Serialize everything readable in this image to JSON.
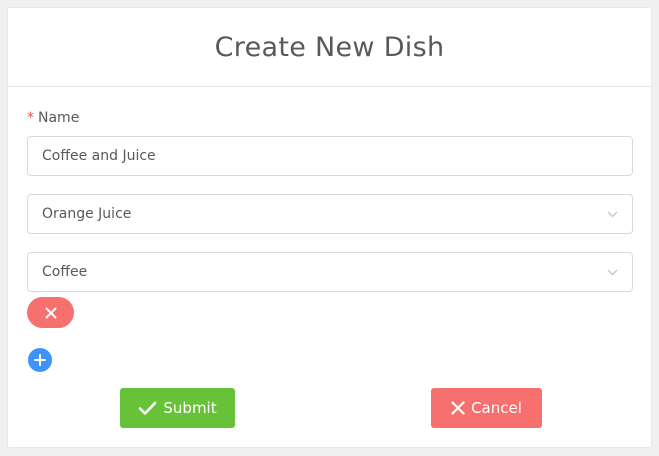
{
  "header": {
    "title": "Create New Dish"
  },
  "form": {
    "name_label": "Name",
    "required_mark": "*",
    "name_value": "Coffee and Juice",
    "selects": [
      {
        "value": "Orange Juice"
      },
      {
        "value": "Coffee"
      }
    ]
  },
  "actions": {
    "submit_label": "Submit",
    "cancel_label": "Cancel"
  },
  "colors": {
    "submit": "#67c23a",
    "cancel": "#f5706f",
    "add": "#3d94f6",
    "remove": "#f5706f"
  },
  "icons": {
    "remove": "close-icon",
    "add": "plus-icon",
    "submit": "check-icon",
    "cancel": "close-icon",
    "select": "chevron-down-icon"
  }
}
